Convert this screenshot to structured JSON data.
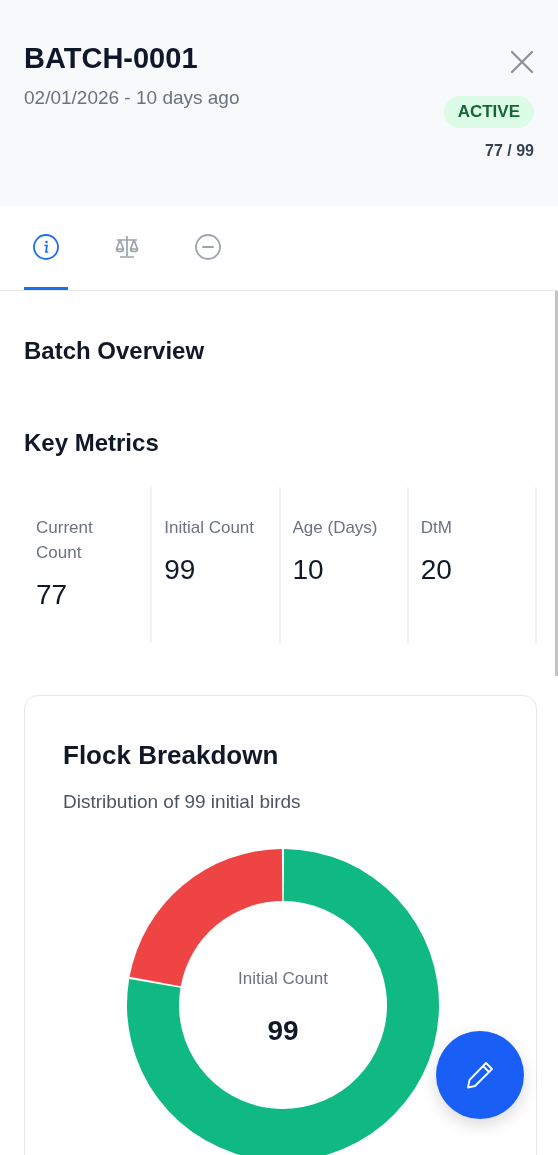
{
  "header": {
    "title": "BATCH-0001",
    "subtitle": "02/01/2026 - 10 days ago",
    "status": "ACTIVE",
    "count": "77 / 99"
  },
  "tabs": [
    {
      "kind": "info",
      "selected": true
    },
    {
      "kind": "scale",
      "selected": false
    },
    {
      "kind": "minus",
      "selected": false
    }
  ],
  "overview": {
    "title": "Batch Overview"
  },
  "key_metrics": {
    "title": "Key Metrics",
    "items": [
      {
        "label": "Current Count",
        "value": "77"
      },
      {
        "label": "Initial Count",
        "value": "99"
      },
      {
        "label": "Age (Days)",
        "value": "10"
      },
      {
        "label": "DtM",
        "value": "20"
      }
    ]
  },
  "flock_breakdown": {
    "title": "Flock Breakdown",
    "subtitle": "Distribution of 99 initial birds",
    "center_label": "Initial Count",
    "center_value": "99"
  }
}
